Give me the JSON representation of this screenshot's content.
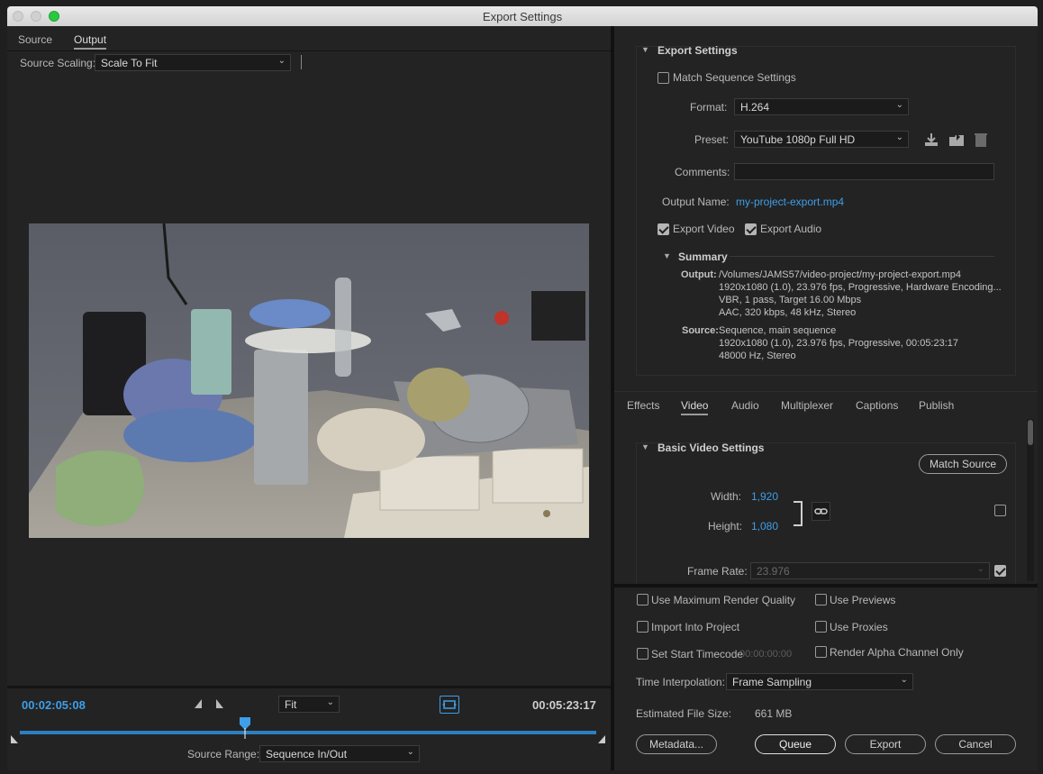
{
  "window": {
    "title": "Export Settings"
  },
  "left": {
    "tabs": [
      "Source",
      "Output"
    ],
    "source_scaling_label": "Source Scaling:",
    "source_scaling_value": "Scale To Fit",
    "current_time": "00:02:05:08",
    "duration": "00:05:23:17",
    "fit_value": "Fit",
    "source_range_label": "Source Range:",
    "source_range_value": "Sequence In/Out",
    "playhead_fraction": 0.39
  },
  "export_settings": {
    "header": "Export Settings",
    "match_sequence": "Match Sequence Settings",
    "format_label": "Format:",
    "format_value": "H.264",
    "preset_label": "Preset:",
    "preset_value": "YouTube 1080p Full HD",
    "comments_label": "Comments:",
    "output_name_label": "Output Name:",
    "output_name_value": "my-project-export.mp4",
    "export_video": "Export Video",
    "export_audio": "Export Audio",
    "summary_header": "Summary",
    "output_label": "Output:",
    "output_lines": [
      "/Volumes/JAMS57/video-project/my-project-export.mp4",
      "1920x1080 (1.0), 23.976 fps, Progressive, Hardware Encoding...",
      "VBR, 1 pass, Target 16.00 Mbps",
      "AAC, 320 kbps, 48 kHz, Stereo"
    ],
    "source_label": "Source:",
    "source_lines": [
      "Sequence, main sequence",
      "1920x1080 (1.0), 23.976 fps, Progressive, 00:05:23:17",
      "48000 Hz, Stereo"
    ]
  },
  "settings_tabs": [
    "Effects",
    "Video",
    "Audio",
    "Multiplexer",
    "Captions",
    "Publish"
  ],
  "video": {
    "header": "Basic Video Settings",
    "match_source": "Match Source",
    "width_label": "Width:",
    "width_value": "1,920",
    "height_label": "Height:",
    "height_value": "1,080",
    "frame_rate_label": "Frame Rate:",
    "frame_rate_value": "23.976"
  },
  "bottom": {
    "max_render": "Use Maximum Render Quality",
    "use_previews": "Use Previews",
    "import_project": "Import Into Project",
    "use_proxies": "Use Proxies",
    "set_start_tc": "Set Start Timecode",
    "start_tc_value": "00:00:00:00",
    "render_alpha": "Render Alpha Channel Only",
    "time_interp_label": "Time Interpolation:",
    "time_interp_value": "Frame Sampling",
    "est_size_label": "Estimated File Size:",
    "est_size_value": "661 MB",
    "metadata": "Metadata...",
    "queue": "Queue",
    "export": "Export",
    "cancel": "Cancel"
  },
  "colors": {
    "accent": "#3e9ee8",
    "bg": "#232323"
  }
}
